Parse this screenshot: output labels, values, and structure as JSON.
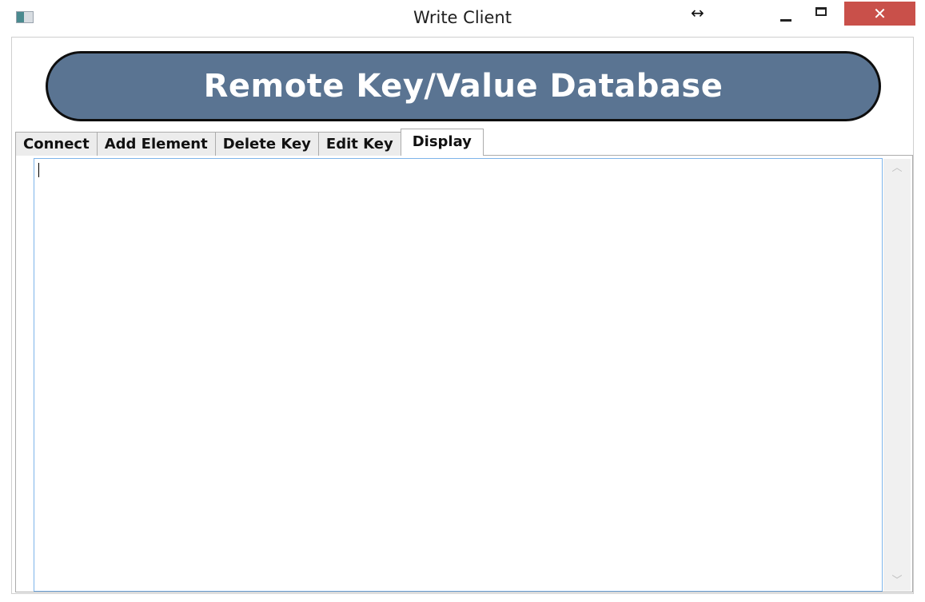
{
  "window": {
    "title": "Write Client",
    "resize_glyph": "↔",
    "close_glyph": "✕",
    "icons": {
      "app": "app-icon",
      "minimize": "minimize-icon",
      "maximize": "maximize-icon",
      "close": "close-icon"
    },
    "colors": {
      "close_button": "#c9504a"
    }
  },
  "banner": {
    "title": "Remote Key/Value Database",
    "colors": {
      "fill": "#5a7492",
      "border": "#0e0e0e",
      "text": "#ffffff"
    }
  },
  "tabs": [
    {
      "label": "Connect",
      "active": false
    },
    {
      "label": "Add Element",
      "active": false
    },
    {
      "label": "Delete Key",
      "active": false
    },
    {
      "label": "Edit Key",
      "active": false
    },
    {
      "label": "Display",
      "active": true
    }
  ],
  "display": {
    "content": "",
    "focus_border_color": "#7eb4ea"
  },
  "scrollbar": {
    "up_glyph": "︿",
    "down_glyph": "﹀"
  }
}
